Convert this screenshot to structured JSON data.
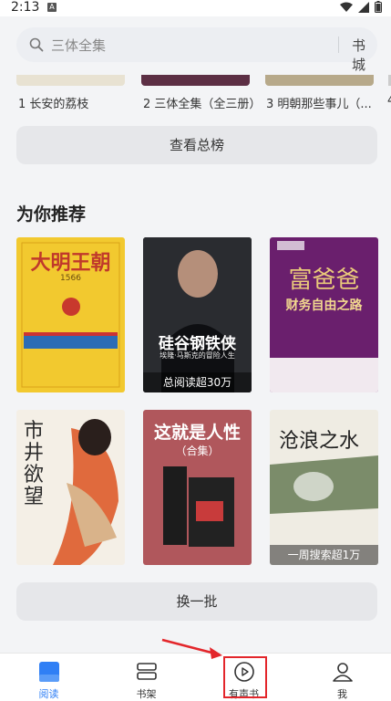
{
  "status_bar": {
    "time": "2:13",
    "badge": "A"
  },
  "search": {
    "placeholder": "三体全集",
    "store_label": "书城"
  },
  "top_ranking": {
    "items": [
      "1 长安的荔枝",
      "2 三体全集（全三册）",
      "3 明朝那些事儿（..."
    ],
    "view_all_label": "查看总榜"
  },
  "recommend": {
    "title": "为你推荐",
    "books": [
      {
        "title": "大明王朝",
        "subtitle": "1566",
        "tag": ""
      },
      {
        "title": "硅谷钢铁侠",
        "subtitle": "埃隆·马斯克的冒险人生",
        "tag": "总阅读超30万"
      },
      {
        "title": "富爸爸",
        "subtitle": "财务自由之路",
        "tag": ""
      },
      {
        "title": "市井欲望",
        "subtitle": "",
        "tag": ""
      },
      {
        "title": "这就是人性",
        "subtitle": "（合集）",
        "tag": ""
      },
      {
        "title": "沧浪之水",
        "subtitle": "",
        "tag": "一周搜索超1万"
      }
    ],
    "refresh_label": "换一批"
  },
  "bottom_nav": {
    "tabs": [
      {
        "label": "阅读",
        "active": true
      },
      {
        "label": "书架",
        "active": false
      },
      {
        "label": "有声书",
        "active": false
      },
      {
        "label": "我",
        "active": false
      }
    ]
  },
  "colors": {
    "accent": "#2f7ff5",
    "highlight": "#e3262b"
  }
}
